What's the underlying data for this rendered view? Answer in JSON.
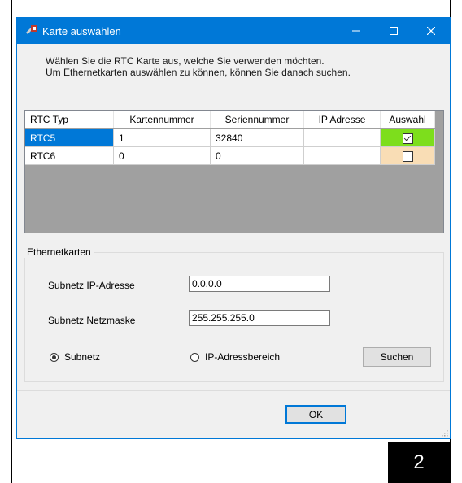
{
  "window": {
    "title": "Karte auswählen"
  },
  "intro": {
    "line1": "Wählen Sie die RTC Karte aus, welche Sie verwenden möchten.",
    "line2": "Um Ethernetkarten auswählen zu können, können Sie danach suchen."
  },
  "table": {
    "headers": [
      "RTC Typ",
      "Kartennummer",
      "Seriennummer",
      "IP Adresse",
      "Auswahl"
    ],
    "rows": [
      {
        "type": "RTC5",
        "card": "1",
        "serial": "32840",
        "ip": "",
        "selected": true
      },
      {
        "type": "RTC6",
        "card": "0",
        "serial": "0",
        "ip": "",
        "selected": false
      }
    ]
  },
  "ethernet": {
    "group_label": "Ethernetkarten",
    "subnet_ip_label": "Subnetz IP-Adresse",
    "subnet_ip_value": "0.0.0.0",
    "subnet_mask_label": "Subnetz Netzmaske",
    "subnet_mask_value": "255.255.255.0",
    "radio_subnet": "Subnetz",
    "radio_range": "IP-Adressbereich",
    "search_button": "Suchen"
  },
  "footer": {
    "ok_button": "OK"
  },
  "badge": "2",
  "colors": {
    "titlebar": "#0078d7",
    "selected_cell": "#0078d7",
    "checked_cell": "#7dde1c",
    "unchecked_cell": "#f9ddb5"
  }
}
